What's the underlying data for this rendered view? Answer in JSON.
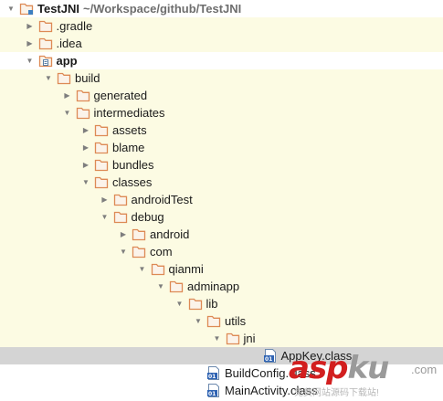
{
  "project": {
    "name": "TestJNI",
    "path": "~/Workspace/github/TestJNI"
  },
  "tree": [
    {
      "label": "TestJNI",
      "suffix": "~/Workspace/github/TestJNI",
      "depth": 0,
      "arrow": "expanded",
      "icon": "project-folder-icon",
      "bold": true,
      "shade": false
    },
    {
      "label": ".gradle",
      "depth": 1,
      "arrow": "collapsed",
      "icon": "folder-icon",
      "shade": true
    },
    {
      "label": ".idea",
      "depth": 1,
      "arrow": "collapsed",
      "icon": "folder-icon",
      "shade": true
    },
    {
      "label": "app",
      "depth": 1,
      "arrow": "expanded",
      "icon": "module-folder-icon",
      "bold": true,
      "shade": false
    },
    {
      "label": "build",
      "depth": 2,
      "arrow": "expanded",
      "icon": "folder-icon",
      "shade": true
    },
    {
      "label": "generated",
      "depth": 3,
      "arrow": "collapsed",
      "icon": "folder-icon",
      "shade": true
    },
    {
      "label": "intermediates",
      "depth": 3,
      "arrow": "expanded",
      "icon": "folder-icon",
      "shade": true
    },
    {
      "label": "assets",
      "depth": 4,
      "arrow": "collapsed",
      "icon": "folder-icon",
      "shade": true
    },
    {
      "label": "blame",
      "depth": 4,
      "arrow": "collapsed",
      "icon": "folder-icon",
      "shade": true
    },
    {
      "label": "bundles",
      "depth": 4,
      "arrow": "collapsed",
      "icon": "folder-icon",
      "shade": true
    },
    {
      "label": "classes",
      "depth": 4,
      "arrow": "expanded",
      "icon": "folder-icon",
      "shade": true
    },
    {
      "label": "androidTest",
      "depth": 5,
      "arrow": "collapsed",
      "icon": "folder-icon",
      "shade": true
    },
    {
      "label": "debug",
      "depth": 5,
      "arrow": "expanded",
      "icon": "folder-icon",
      "shade": true
    },
    {
      "label": "android",
      "depth": 6,
      "arrow": "collapsed",
      "icon": "folder-icon",
      "shade": true
    },
    {
      "label": "com",
      "depth": 6,
      "arrow": "expanded",
      "icon": "folder-icon",
      "shade": true
    },
    {
      "label": "qianmi",
      "depth": 7,
      "arrow": "expanded",
      "icon": "folder-icon",
      "shade": true
    },
    {
      "label": "adminapp",
      "depth": 8,
      "arrow": "expanded",
      "icon": "folder-icon",
      "shade": true
    },
    {
      "label": "lib",
      "depth": 9,
      "arrow": "expanded",
      "icon": "folder-icon",
      "shade": true
    },
    {
      "label": "utils",
      "depth": 10,
      "arrow": "expanded",
      "icon": "folder-icon",
      "shade": true
    },
    {
      "label": "jni",
      "depth": 11,
      "arrow": "expanded",
      "icon": "folder-icon",
      "shade": true
    },
    {
      "label": "AppKey.class",
      "depth": 13,
      "arrow": "none",
      "icon": "class-file-icon",
      "shade": false,
      "selected": true
    },
    {
      "label": "BuildConfig.class",
      "depth": 10,
      "arrow": "none",
      "icon": "class-file-icon",
      "shade": false
    },
    {
      "label": "MainActivity.class",
      "depth": 10,
      "arrow": "none",
      "icon": "class-file-icon",
      "shade": false
    }
  ],
  "watermark": {
    "part1": "asp",
    "part2": "ku",
    "suffix": ".com",
    "subtitle": "免费网站源码下载站!"
  },
  "colors": {
    "folder": "#dd8a55",
    "shade": "#fcfbe3",
    "selected": "#d4d4d4",
    "watermark_red": "#d21f1f"
  }
}
